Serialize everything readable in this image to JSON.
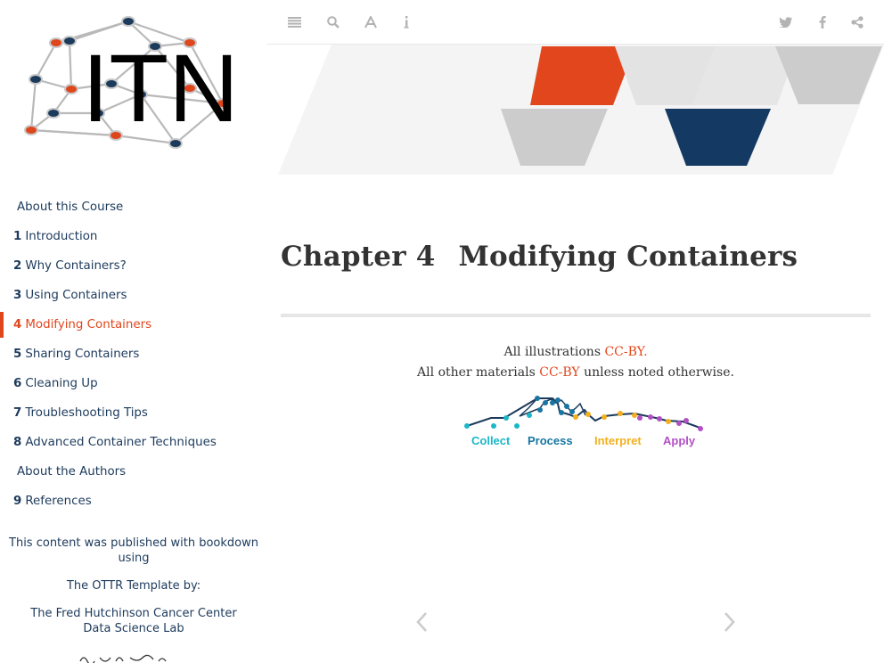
{
  "logo": {
    "text": "ITN"
  },
  "toc": {
    "items": [
      {
        "num": "",
        "label": "About this Course"
      },
      {
        "num": "1",
        "label": "Introduction"
      },
      {
        "num": "2",
        "label": "Why Containers?"
      },
      {
        "num": "3",
        "label": "Using Containers"
      },
      {
        "num": "4",
        "label": "Modifying Containers",
        "active": true
      },
      {
        "num": "5",
        "label": "Sharing Containers"
      },
      {
        "num": "6",
        "label": "Cleaning Up"
      },
      {
        "num": "7",
        "label": "Troubleshooting Tips"
      },
      {
        "num": "8",
        "label": "Advanced Container Techniques"
      },
      {
        "num": "",
        "label": "About the Authors"
      },
      {
        "num": "9",
        "label": "References"
      }
    ]
  },
  "sidebar_notes": {
    "bookdown": "This content was published with bookdown using",
    "ottr": "The OTTR Template by:",
    "fhcc": "The Fred Hutchinson Cancer Center Data Science Lab"
  },
  "toolbar": {
    "left_icons": [
      "toc-toggle-icon",
      "search-icon",
      "font-settings-icon",
      "info-icon"
    ],
    "right_icons": [
      "twitter-icon",
      "facebook-icon",
      "share-icon"
    ],
    "icon_color": "#b3b3b3"
  },
  "chapter": {
    "number_label": "Chapter 4",
    "title": "Modifying Containers"
  },
  "license": {
    "line1_prefix": "All illustrations ",
    "line1_link": "CC-BY.",
    "line2_prefix": "All other materials ",
    "line2_link": "CC-BY",
    "line2_suffix": " unless noted otherwise."
  },
  "ottr_graphic": {
    "labels": [
      "Collect",
      "Process",
      "Interpret",
      "Apply"
    ],
    "colors": [
      "#1ab7c9",
      "#1776a3",
      "#f2b01e",
      "#b34fc6"
    ]
  },
  "colors": {
    "accent": "#e0461c",
    "navy": "#1c3a5c",
    "banner_navy": "#143a63",
    "banner_gray": "#cccccc"
  }
}
